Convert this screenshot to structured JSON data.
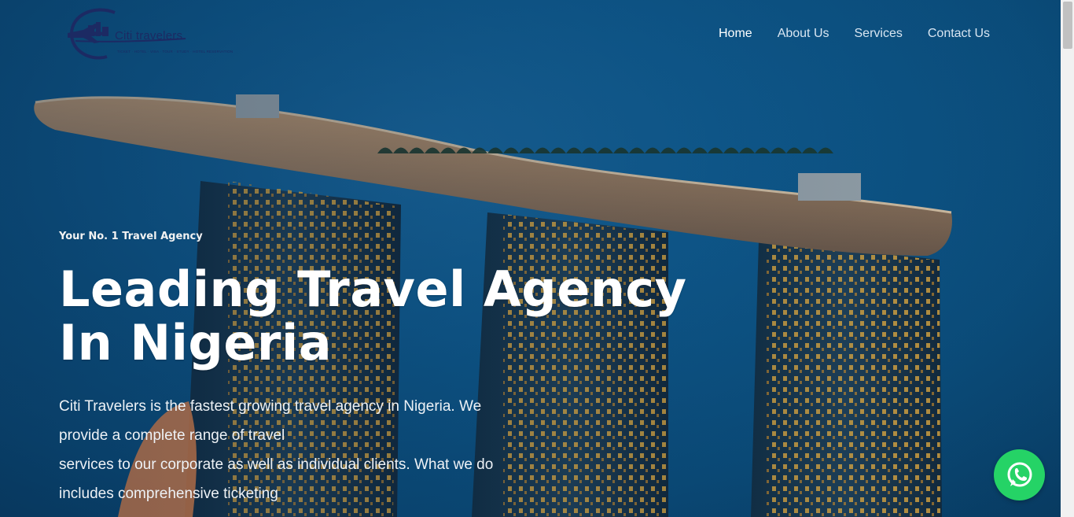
{
  "brand": {
    "name": "Citi travelers",
    "tagline": "TICKET · HOTEL · VISA · TOUR · STUDY · HOTEL RESERVATION",
    "logo_color": "#1c2a63"
  },
  "nav": {
    "items": [
      {
        "label": "Home",
        "active": true
      },
      {
        "label": "About Us",
        "active": false
      },
      {
        "label": "Services",
        "active": false
      },
      {
        "label": "Contact Us",
        "active": false
      }
    ]
  },
  "hero": {
    "eyebrow": "Your No. 1 Travel Agency",
    "headline": "Leading Travel Agency In Nigeria",
    "description_lines": [
      "Citi Travelers is the fastest growing travel agency in Nigeria. We",
      "provide a complete range of travel",
      "services to our corporate as well as individual clients. What we do",
      "includes comprehensive ticketing"
    ]
  },
  "whatsapp": {
    "icon": "whatsapp-icon",
    "color": "#25d366"
  },
  "colors": {
    "sky": "#0f5d92",
    "text_white": "#ffffff"
  }
}
